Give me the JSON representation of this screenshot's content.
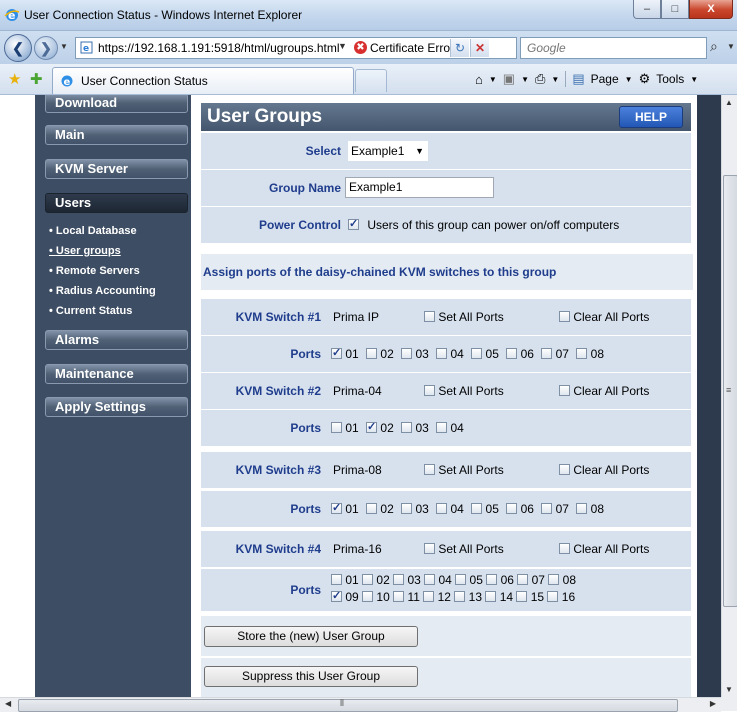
{
  "window": {
    "title": "User Connection Status - Windows Internet Explorer"
  },
  "address": {
    "url": "https://192.168.1.191:5918/html/ugroups.html",
    "cert_error": "Certificate Error",
    "search_placeholder": "Google"
  },
  "commandbar": {
    "tab_title": "User Connection Status",
    "page_label": "Page",
    "tools_label": "Tools"
  },
  "sidebar": {
    "buttons_top": [
      "Download",
      "Main",
      "KVM Server"
    ],
    "users": "Users",
    "submenu": [
      "Local Database",
      "User groups",
      "Remote Servers",
      "Radius Accounting",
      "Current Status"
    ],
    "buttons_bottom": [
      "Alarms",
      "Maintenance",
      "Apply Settings"
    ]
  },
  "main": {
    "header": "User Groups",
    "help": "HELP",
    "select_label": "Select",
    "select_value": "Example1",
    "group_name_label": "Group Name",
    "group_name_value": "Example1",
    "power_label": "Power Control",
    "power_text": "Users of this group can power on/off computers",
    "assign_text": "Assign ports of the daisy-chained KVM switches to this group",
    "ports_label": "Ports",
    "set_all": "Set All Ports",
    "clear_all": "Clear All Ports",
    "switches": [
      {
        "label": "KVM Switch #1",
        "name": "Prima IP"
      },
      {
        "label": "KVM Switch #2",
        "name": "Prima-04"
      },
      {
        "label": "KVM Switch #3",
        "name": "Prima-08"
      },
      {
        "label": "KVM Switch #4",
        "name": "Prima-16"
      }
    ],
    "ports": {
      "s1": [
        "01",
        "02",
        "03",
        "04",
        "05",
        "06",
        "07",
        "08"
      ],
      "s2": [
        "01",
        "02",
        "03",
        "04"
      ],
      "s3": [
        "01",
        "02",
        "03",
        "04",
        "05",
        "06",
        "07",
        "08"
      ],
      "s4a": [
        "01",
        "02",
        "03",
        "04",
        "05",
        "06",
        "07",
        "08"
      ],
      "s4b": [
        "09",
        "10",
        "11",
        "12",
        "13",
        "14",
        "15",
        "16"
      ]
    },
    "store_button": "Store the (new) User Group",
    "suppress_button": "Suppress this User Group"
  }
}
